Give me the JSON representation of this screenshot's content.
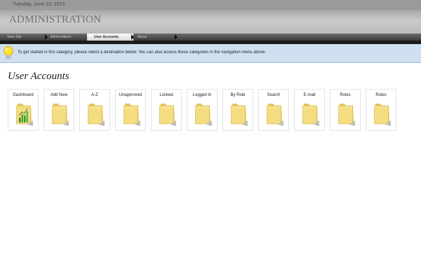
{
  "header": {
    "date": "Tuesday, June 23, 2015",
    "title": "ADMINISTRATION"
  },
  "nav": {
    "items": [
      {
        "label": "View Site",
        "active": false
      },
      {
        "label": "Admin Admin",
        "active": false
      },
      {
        "label": "User Accounts",
        "active": true
      },
      {
        "label": "About",
        "active": false
      }
    ]
  },
  "info": {
    "icon": "lightbulb-icon",
    "text": "To get started in this category, please select a destination below. You can also access these categories in the navigation menu above."
  },
  "main": {
    "title": "User Accounts",
    "tiles": [
      {
        "label": "Dashboard",
        "icon": "dashboard-chart-folder-icon"
      },
      {
        "label": "Add New",
        "icon": "folder-icon"
      },
      {
        "label": "A-Z",
        "icon": "folder-icon"
      },
      {
        "label": "Unapproved",
        "icon": "folder-icon"
      },
      {
        "label": "Locked",
        "icon": "folder-icon"
      },
      {
        "label": "Logged In",
        "icon": "folder-icon"
      },
      {
        "label": "By Role",
        "icon": "folder-icon"
      },
      {
        "label": "Search",
        "icon": "folder-icon"
      },
      {
        "label": "E-mail",
        "icon": "folder-icon"
      },
      {
        "label": "Roles",
        "icon": "folder-icon"
      },
      {
        "label": "Rules",
        "icon": "folder-icon"
      }
    ]
  },
  "colors": {
    "info_background": "#cfe0f1",
    "folder": "#f2d77a",
    "chart_bars": "#4a9a3a"
  }
}
